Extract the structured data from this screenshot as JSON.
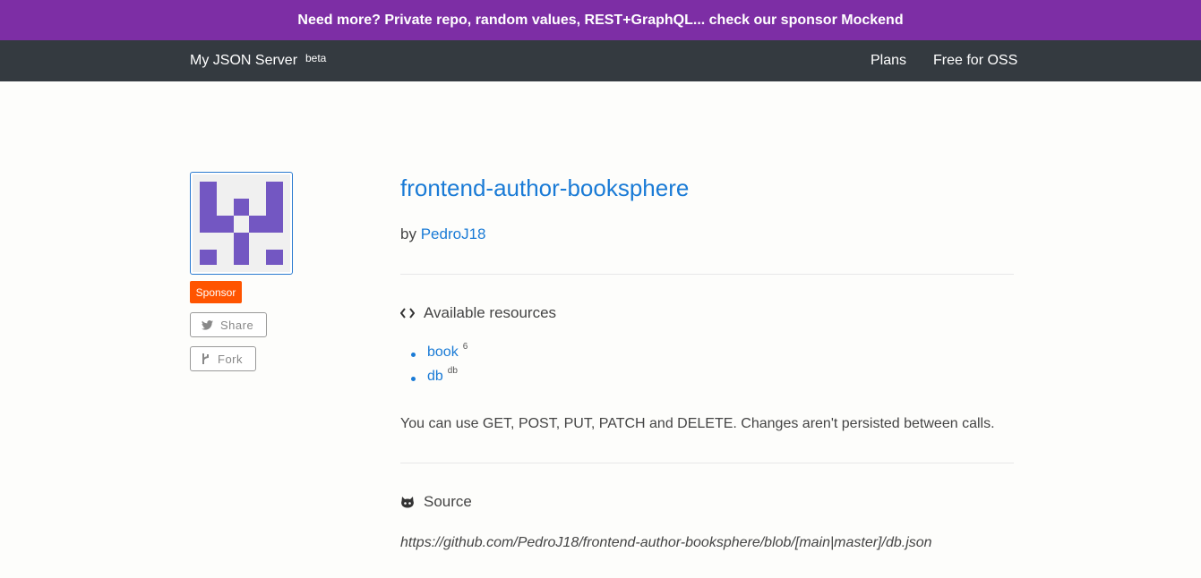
{
  "promo": {
    "text": "Need more? Private repo, random values, REST+GraphQL... check our sponsor Mockend",
    "bg": "#7d2ea5"
  },
  "navbar": {
    "brand": "My JSON Server",
    "badge": "beta",
    "links": [
      "Plans",
      "Free for OSS"
    ]
  },
  "sidebar": {
    "avatar_icon": "identicon",
    "avatar_color": "#7357c2",
    "sponsor_label": "Sponsor",
    "share_label": "Share",
    "share_icon": "twitter-icon",
    "fork_label": "Fork",
    "fork_icon": "git-fork-icon"
  },
  "repo": {
    "title": "frontend-author-booksphere",
    "by_label": "by",
    "author": "PedroJ18"
  },
  "resources": {
    "heading": "Available resources",
    "icon": "code-icon",
    "items": [
      {
        "name": "book",
        "count": "6"
      },
      {
        "name": "db",
        "count": "db"
      }
    ],
    "info": "You can use GET, POST, PUT, PATCH and DELETE. Changes aren't persisted between calls."
  },
  "source": {
    "heading": "Source",
    "icon": "github-icon",
    "url": "https://github.com/PedroJ18/frontend-author-booksphere/blob/[main|master]/db.json"
  }
}
